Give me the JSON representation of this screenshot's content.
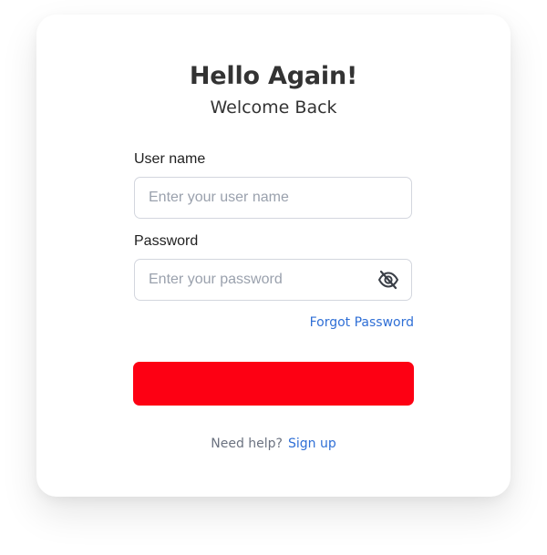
{
  "header": {
    "title": "Hello Again!",
    "subtitle": "Welcome Back"
  },
  "form": {
    "username": {
      "label": "User name",
      "placeholder": "Enter your user name",
      "value": ""
    },
    "password": {
      "label": "Password",
      "placeholder": "Enter your password",
      "value": "",
      "toggle_icon": "eye-off-icon"
    },
    "forgot_label": "Forgot Password",
    "submit_label": ""
  },
  "footer": {
    "help_text": "Need help?",
    "signup_label": "Sign up"
  },
  "colors": {
    "accent": "#2f6fd6",
    "submit": "#fd0013",
    "text": "#333333"
  }
}
